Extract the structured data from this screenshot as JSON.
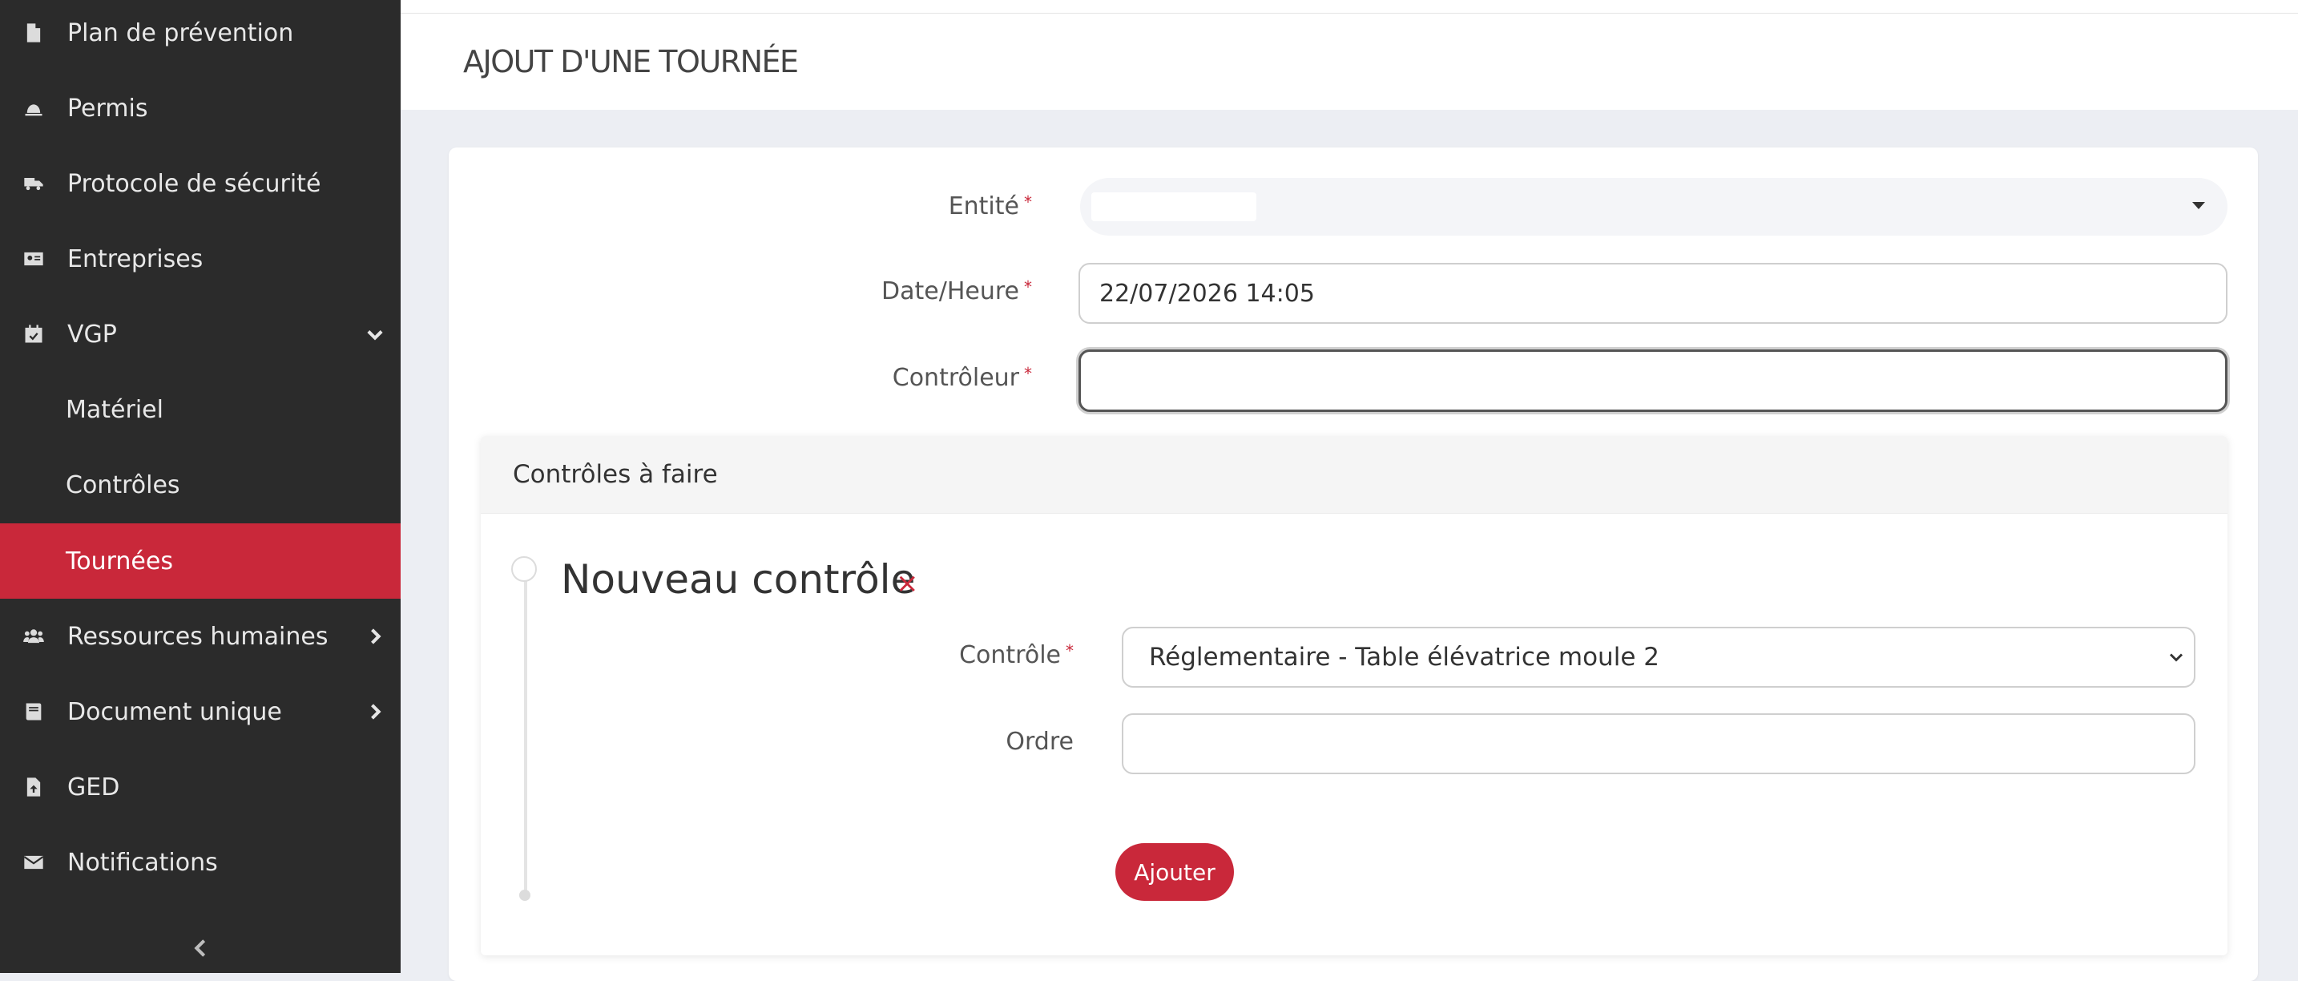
{
  "sidebar": {
    "items": [
      {
        "label": "Plan de prévention",
        "icon": "file-icon"
      },
      {
        "label": "Permis",
        "icon": "helmet-icon"
      },
      {
        "label": "Protocole de sécurité",
        "icon": "truck-icon"
      },
      {
        "label": "Entreprises",
        "icon": "id-card-icon"
      },
      {
        "label": "VGP",
        "icon": "calendar-check-icon"
      },
      {
        "label": "Matériel"
      },
      {
        "label": "Contrôles"
      },
      {
        "label": "Tournées"
      },
      {
        "label": "Ressources humaines",
        "icon": "users-icon"
      },
      {
        "label": "Document unique",
        "icon": "book-icon"
      },
      {
        "label": "GED",
        "icon": "file-upload-icon"
      },
      {
        "label": "Notifications",
        "icon": "envelope-icon"
      }
    ],
    "active": "Tournées"
  },
  "header": {
    "title": "AJOUT D'UNE TOURNÉE"
  },
  "form": {
    "entity": {
      "label": "Entité",
      "required_mark": "*",
      "value": ""
    },
    "datetime": {
      "label": "Date/Heure",
      "required_mark": "*",
      "value": "22/07/2026 14:05"
    },
    "controller": {
      "label": "Contrôleur",
      "required_mark": "*",
      "value": ""
    }
  },
  "controls_panel": {
    "title": "Contrôles à faire",
    "new_control_title": "Nouveau contrôle",
    "remove_glyph": "×",
    "control": {
      "label": "Contrôle",
      "required_mark": "*",
      "value": "Réglementaire - Table élévatrice moule 2"
    },
    "order": {
      "label": "Ordre",
      "value": ""
    },
    "add_button": "Ajouter"
  },
  "colors": {
    "accent": "#c9283a",
    "sidebar_bg": "#2b2b2b"
  }
}
